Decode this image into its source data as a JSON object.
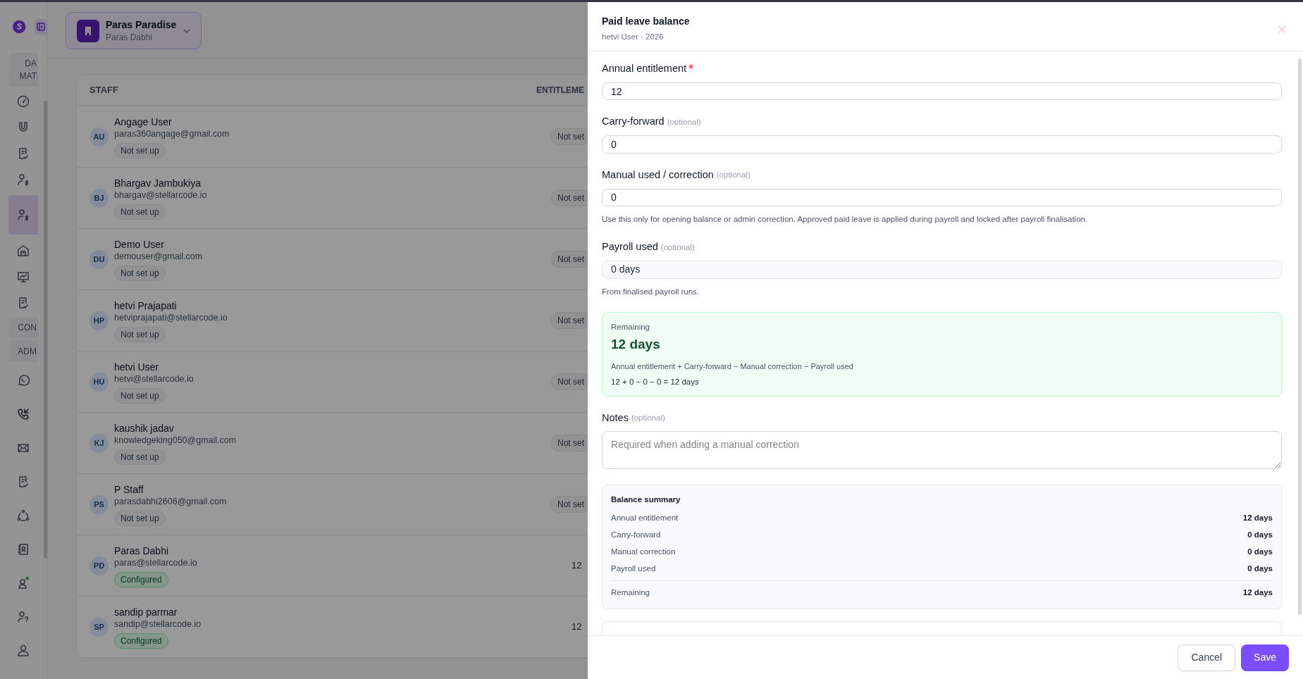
{
  "sidebar": {
    "items": [
      {
        "kind": "label",
        "lines": [
          "DA",
          "MAT"
        ]
      },
      {
        "kind": "icon",
        "selected": false
      },
      {
        "kind": "icon",
        "selected": false
      },
      {
        "kind": "icon",
        "selected": false
      },
      {
        "kind": "icon",
        "selected": false
      },
      {
        "kind": "icon",
        "selected": true
      },
      {
        "kind": "icon",
        "selected": false
      },
      {
        "kind": "icon",
        "selected": false
      },
      {
        "kind": "icon",
        "selected": false
      },
      {
        "kind": "label",
        "lines": [
          "CON"
        ]
      },
      {
        "kind": "label",
        "lines": [
          "ADM"
        ]
      },
      {
        "kind": "icon",
        "selected": false
      },
      {
        "kind": "icon",
        "selected": false
      },
      {
        "kind": "icon",
        "selected": false
      },
      {
        "kind": "icon",
        "selected": false
      },
      {
        "kind": "icon",
        "selected": false
      },
      {
        "kind": "icon",
        "selected": false
      },
      {
        "kind": "icon",
        "selected": false
      },
      {
        "kind": "icon",
        "selected": false
      },
      {
        "kind": "icon",
        "selected": false
      }
    ]
  },
  "workspace": {
    "name": "Paras Paradise",
    "owner": "Paras Dabhi"
  },
  "staff_table": {
    "columns": [
      "STAFF",
      "ENTITLEME"
    ],
    "rows": [
      {
        "initials": "AU",
        "name": "Angage User",
        "email": "paras360angage@gmail.com",
        "status": {
          "text": "Not set up",
          "kind": "not_set"
        },
        "entitlement": {
          "text": "Not set",
          "kind": "pill"
        }
      },
      {
        "initials": "BJ",
        "name": "Bhargav Jambukiya",
        "email": "bhargav@stellarcode.io",
        "status": {
          "text": "Not set up",
          "kind": "not_set"
        },
        "entitlement": {
          "text": "Not set",
          "kind": "pill"
        }
      },
      {
        "initials": "DU",
        "name": "Demo User",
        "email": "demouser@gmail.com",
        "status": {
          "text": "Not set up",
          "kind": "not_set"
        },
        "entitlement": {
          "text": "Not set",
          "kind": "pill"
        }
      },
      {
        "initials": "HP",
        "name": "hetvi Prajapati",
        "email": "hetviprajapati@stellarcode.io",
        "status": {
          "text": "Not set up",
          "kind": "not_set"
        },
        "entitlement": {
          "text": "Not set",
          "kind": "pill"
        }
      },
      {
        "initials": "HU",
        "name": "hetvi User",
        "email": "hetvi@stellarcode.io",
        "status": {
          "text": "Not set up",
          "kind": "not_set"
        },
        "entitlement": {
          "text": "Not set",
          "kind": "pill"
        }
      },
      {
        "initials": "KJ",
        "name": "kaushik jadav",
        "email": "knowledgeking050@gmail.com",
        "status": {
          "text": "Not set up",
          "kind": "not_set"
        },
        "entitlement": {
          "text": "Not set",
          "kind": "pill"
        }
      },
      {
        "initials": "PS",
        "name": "P Staff",
        "email": "parasdabhi2606@gmail.com",
        "status": {
          "text": "Not set up",
          "kind": "not_set"
        },
        "entitlement": {
          "text": "Not set",
          "kind": "pill"
        }
      },
      {
        "initials": "PD",
        "name": "Paras Dabhi",
        "email": "paras@stellarcode.io",
        "status": {
          "text": "Configured",
          "kind": "configured"
        },
        "entitlement": {
          "text": "12",
          "kind": "value"
        }
      },
      {
        "initials": "SP",
        "name": "sandip parmar",
        "email": "sandip@stellarcode.io",
        "status": {
          "text": "Configured",
          "kind": "configured"
        },
        "entitlement": {
          "text": "12",
          "kind": "value"
        }
      }
    ]
  },
  "drawer": {
    "title": "Paid leave balance",
    "subtitle": "hetvi User · 2026",
    "body": [
      {
        "kind": "input",
        "label": "Annual entitlement",
        "required": true,
        "value": "12"
      },
      {
        "kind": "input",
        "label": "Carry-forward",
        "required": false,
        "optional_note": "(optional)",
        "value": "0"
      },
      {
        "kind": "input",
        "label": "Manual used / correction",
        "required": false,
        "optional_note": "(optional)",
        "value": "0",
        "help": "Use this only for opening balance or admin correction. Approved paid leave is applied during payroll and locked after payroll finalisation."
      },
      {
        "kind": "readonly",
        "label": "Payroll used",
        "required": false,
        "optional_note": "(optional)",
        "value": "0 days",
        "help": "From finalised payroll runs."
      },
      {
        "kind": "remaining",
        "label": "Remaining",
        "value": "12 days",
        "formula": "Annual entitlement + Carry-forward − Manual correction − Payroll used",
        "equation": "12 + 0 − 0 − 0 = 12 days"
      },
      {
        "kind": "textarea",
        "label": "Notes",
        "required": false,
        "optional_note": "(optional)",
        "placeholder": "Required when adding a manual correction"
      },
      {
        "kind": "summary",
        "title": "Balance summary",
        "rows": [
          {
            "label": "Annual entitlement",
            "value": "12 days"
          },
          {
            "label": "Carry-forward",
            "value": "0 days"
          },
          {
            "label": "Manual correction",
            "value": "0 days"
          },
          {
            "label": "Payroll used",
            "value": "0 days"
          }
        ],
        "total": {
          "label": "Remaining",
          "value": "12 days"
        }
      }
    ],
    "buttons": [
      {
        "label": "Cancel",
        "kind": "secondary"
      },
      {
        "label": "Save",
        "kind": "primary"
      }
    ]
  }
}
